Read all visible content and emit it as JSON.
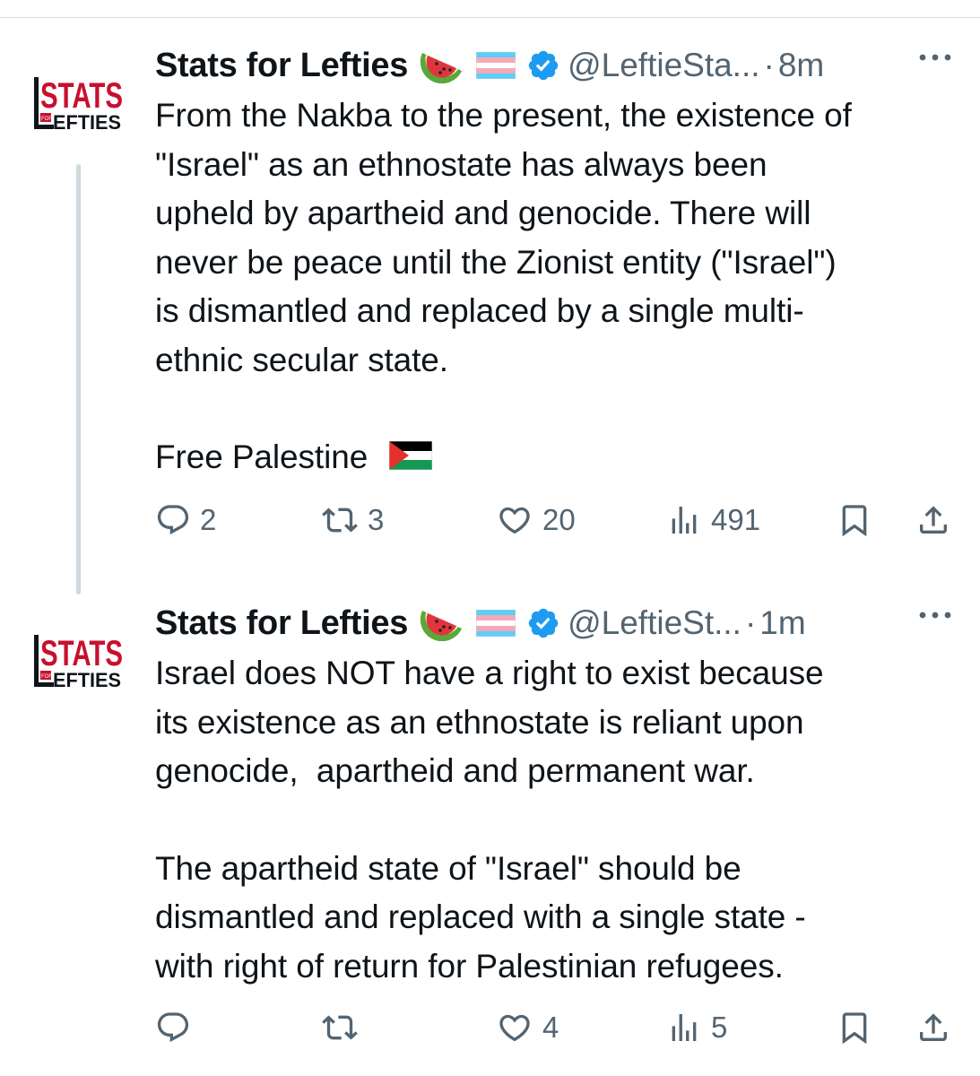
{
  "tweets": [
    {
      "author": {
        "display_name": "Stats for Lefties",
        "handle": "@LeftieSta...",
        "verified": true,
        "badges": [
          "watermelon-emoji",
          "transgender-flag-emoji",
          "verified-badge-icon"
        ],
        "avatar_text": {
          "top": "STATS",
          "middle": "FOR",
          "bottom": "EFTIES",
          "prefix": "L"
        }
      },
      "separator": "·",
      "time": "8m",
      "text_lines": [
        "From the Nakba to the present, the existence of",
        "\"Israel\" as an ethnostate has always been",
        "upheld by apartheid and genocide. There will",
        "never be peace until the Zionist entity (\"Israel\")",
        "is dismantled and replaced by a single multi-",
        "ethnic secular state."
      ],
      "closing_line": "Free Palestine",
      "closing_emoji": "palestine-flag-emoji",
      "stats": {
        "replies": "2",
        "reposts": "3",
        "likes": "20",
        "views": "491"
      }
    },
    {
      "author": {
        "display_name": "Stats for Lefties",
        "handle": "@LeftieSt...",
        "verified": true,
        "badges": [
          "watermelon-emoji",
          "transgender-flag-emoji",
          "verified-badge-icon"
        ],
        "avatar_text": {
          "top": "STATS",
          "middle": "FOR",
          "bottom": "EFTIES",
          "prefix": "L"
        }
      },
      "separator": "·",
      "time": "1m",
      "text_lines": [
        "Israel does NOT have a right to exist because",
        "its existence as an ethnostate is reliant upon",
        "genocide,  apartheid and permanent war."
      ],
      "text_lines_2": [
        "The apartheid state of \"Israel\" should be",
        "dismantled and replaced with a single state -",
        "with right of return for Palestinian refugees."
      ],
      "stats": {
        "replies": "",
        "reposts": "",
        "likes": "4",
        "views": "5"
      }
    }
  ],
  "colors": {
    "text_primary": "#0f1419",
    "text_secondary": "#536471",
    "verified_blue": "#1d9bf0",
    "avatar_red": "#c8102e",
    "thread_line": "#cfd9de"
  },
  "icons": [
    "reply-icon",
    "repost-icon",
    "like-icon",
    "views-icon",
    "bookmark-icon",
    "share-icon",
    "more-icon"
  ]
}
